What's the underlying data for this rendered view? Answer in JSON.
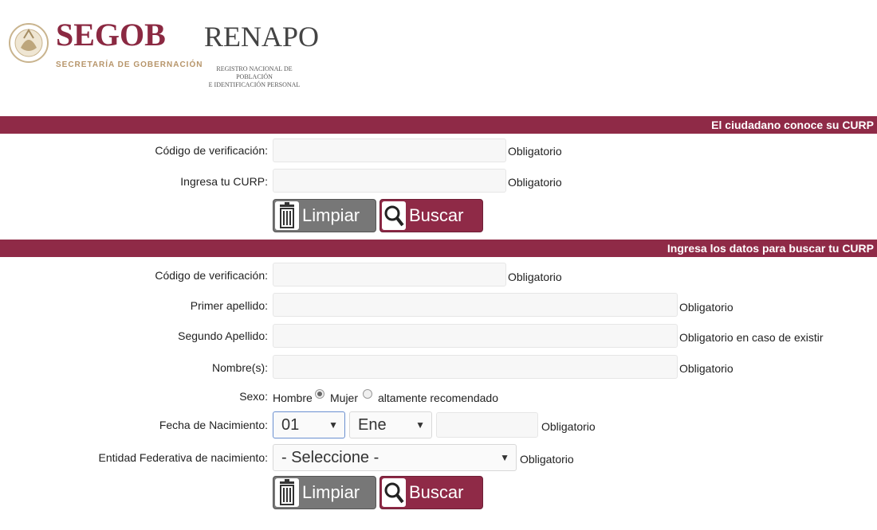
{
  "header": {
    "segob_title": "SEGOB",
    "segob_sub": "SECRETARÍA DE GOBERNACIÓN",
    "renapo_title": "RENAPO",
    "renapo_sub_1": "REGISTRO NACIONAL DE POBLACIÓN",
    "renapo_sub_2": "E IDENTIFICACIÓN PERSONAL"
  },
  "section1": {
    "title": "El ciudadano conoce su CURP",
    "verif_label": "Código de verificación:",
    "verif_req": "Obligatorio",
    "curp_label": "Ingresa tu CURP:",
    "curp_req": "Obligatorio",
    "clear_label": "Limpiar",
    "search_label": "Buscar"
  },
  "section2": {
    "title": "Ingresa los datos para buscar tu CURP",
    "verif_label": "Código de verificación:",
    "verif_req": "Obligatorio",
    "apellido1_label": "Primer apellido:",
    "apellido1_req": "Obligatorio",
    "apellido2_label": "Segundo Apellido:",
    "apellido2_req": "Obligatorio en caso de existir",
    "nombre_label": "Nombre(s):",
    "nombre_req": "Obligatorio",
    "sexo_label": "Sexo:",
    "hombre_label": "Hombre",
    "mujer_label": "Mujer",
    "sexo_note": "altamente recomendado",
    "fecha_label": "Fecha de Nacimiento:",
    "dia_value": "01",
    "mes_value": "Ene",
    "fecha_req": "Obligatorio",
    "entidad_label": "Entidad Federativa de nacimiento:",
    "entidad_value": "- Seleccione -",
    "entidad_req": "Obligatorio",
    "clear_label": "Limpiar",
    "search_label": "Buscar"
  },
  "colors": {
    "brand": "#8f2a47",
    "gold": "#b7956a",
    "button_gray": "#777777"
  }
}
